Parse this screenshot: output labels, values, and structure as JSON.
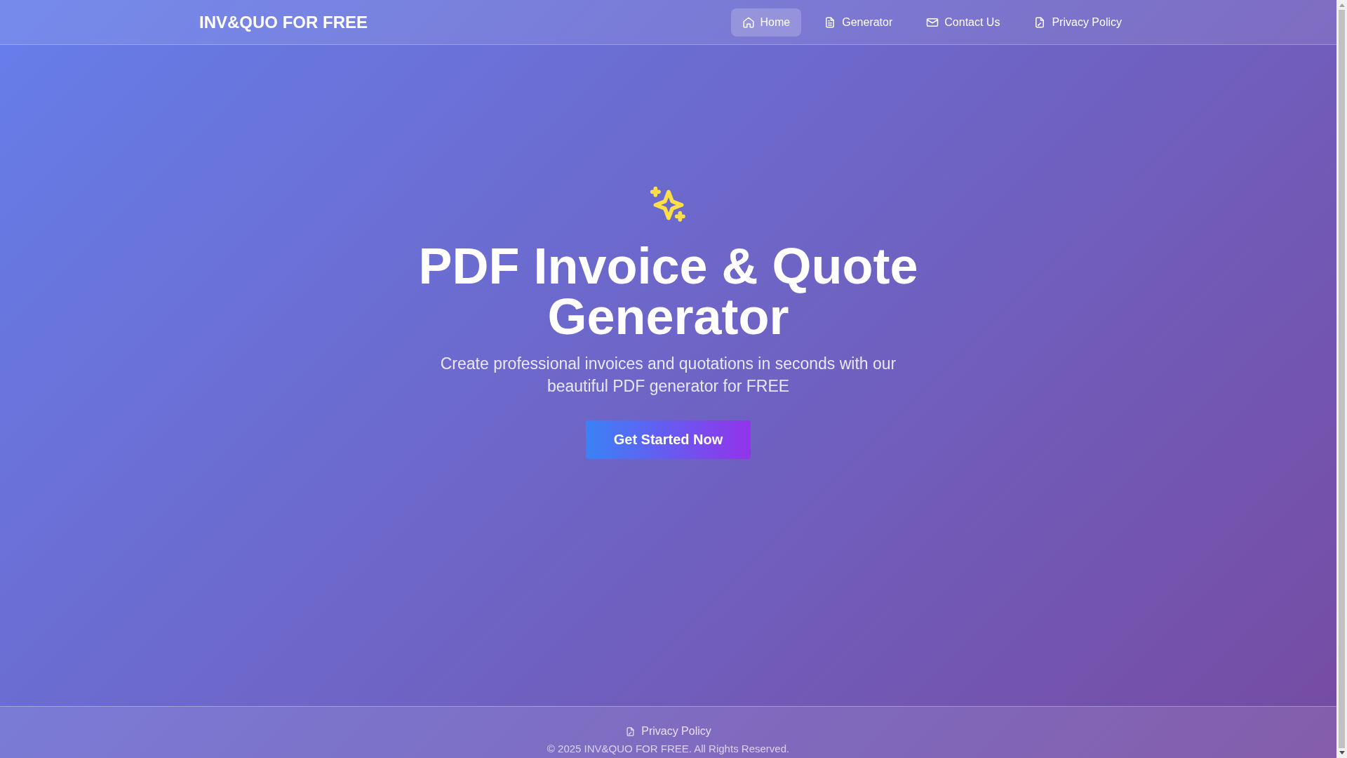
{
  "header": {
    "logo": "INV&QUO FOR FREE",
    "nav": [
      {
        "label": "Home",
        "selected": true
      },
      {
        "label": "Generator",
        "selected": false
      },
      {
        "label": "Contact Us",
        "selected": false
      },
      {
        "label": "Privacy Policy",
        "selected": false
      }
    ]
  },
  "hero": {
    "title": "PDF Invoice & Quote Generator",
    "subtitle": "Create professional invoices and quotations in seconds with our beautiful PDF generator for FREE",
    "button": "Get Started Now"
  },
  "footer": {
    "links": [
      {
        "label": "Privacy Policy"
      }
    ],
    "copyright": "© 2025 INV&QUO FOR FREE. All Rights Reserved."
  }
}
